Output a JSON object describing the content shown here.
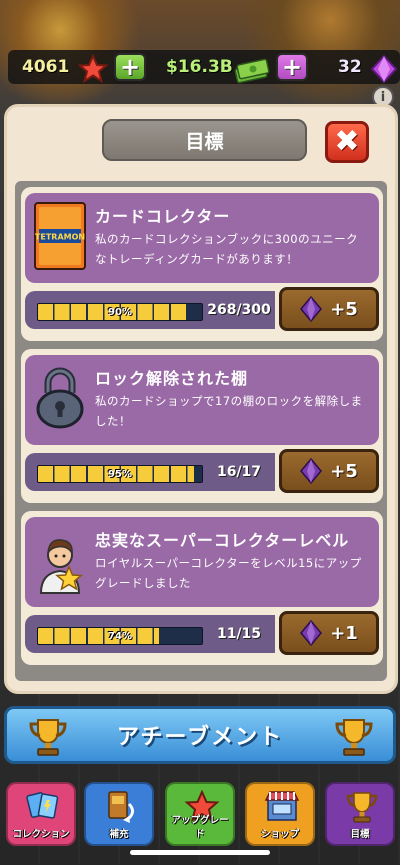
{
  "currencies": {
    "stars": "4061",
    "cash": "$16.3B",
    "gems": "32"
  },
  "modal": {
    "title": "目標",
    "close_symbol": "✖"
  },
  "achievements": [
    {
      "title": "カードコレクター",
      "description": "私のカードコレクションブックに300のユニークなトレーディングカードがあります！",
      "icon_name": "trading-card-icon",
      "card_brand": "TETRAMON",
      "progress_percent": 90,
      "progress_label": "90%",
      "count": "268/300",
      "reward": "+5"
    },
    {
      "title": "ロック解除された棚",
      "description": "私のカードショップで17の棚のロックを解除しました！",
      "icon_name": "padlock-icon",
      "progress_percent": 95,
      "progress_label": "95%",
      "count": "16/17",
      "reward": "+5"
    },
    {
      "title": "忠実なスーパーコレクターレベル",
      "description": "ロイヤルスーパーコレクターをレベル15にアップグレードしました",
      "icon_name": "collector-avatar-icon",
      "progress_percent": 74,
      "progress_label": "74%",
      "count": "11/15",
      "reward": "+1"
    }
  ],
  "achievements_button": {
    "label": "アチーブメント"
  },
  "nav": [
    {
      "label": "コレクション",
      "icon": "cards-icon",
      "color": "#e0457a"
    },
    {
      "label": "補充",
      "icon": "restock-icon",
      "color": "#3a7ed8"
    },
    {
      "label": "アップグレード",
      "icon": "star-icon",
      "color": "#5ab83a"
    },
    {
      "label": "ショップ",
      "icon": "shop-icon",
      "color": "#f0a020"
    },
    {
      "label": "目標",
      "icon": "trophy-icon",
      "color": "#7a3aa8"
    }
  ],
  "colors": {
    "card_header": "#9a6aa6",
    "progress_fill": "#f6cc3a",
    "reward_button": "#8a5a24",
    "banner": "#4a9ee0"
  }
}
